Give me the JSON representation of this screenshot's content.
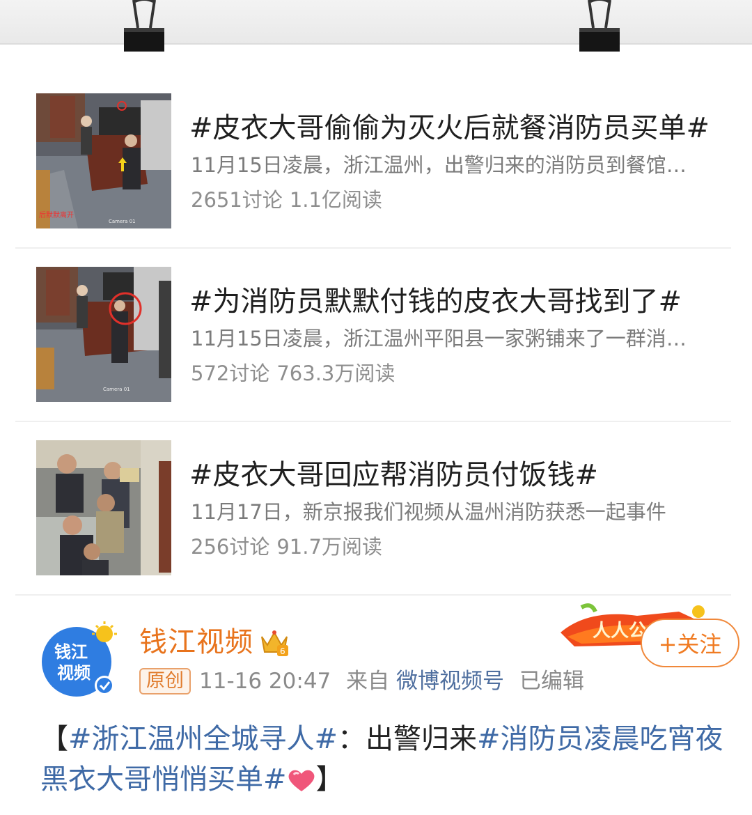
{
  "topics": [
    {
      "title": "#皮衣大哥偷偷为灭火后就餐消防员买单#",
      "desc": "11月15日凌晨，浙江温州，出警归来的消防员到餐馆吃宵夜",
      "discuss": "2651讨论",
      "reads": "1.1亿阅读"
    },
    {
      "title": "#为消防员默默付钱的皮衣大哥找到了#",
      "desc": "11月15日凌晨，浙江温州平阳县一家粥铺来了一群消防员",
      "discuss": "572讨论",
      "reads": "763.3万阅读"
    },
    {
      "title": "#皮衣大哥回应帮消防员付饭钱#",
      "desc": "11月17日，新京报我们视频从温州消防获悉一起事件",
      "discuss": "256讨论",
      "reads": "91.7万阅读"
    }
  ],
  "post": {
    "avatar_text_1": "钱江",
    "avatar_text_2": "视频",
    "username": "钱江视频",
    "crown_level": "6",
    "banner_text": "人人公",
    "follow_label": "+关注",
    "original_badge": "原创",
    "time": "11-16 20:47",
    "from_prefix": "来自",
    "source": "微博视频号",
    "edited": "已编辑",
    "text_bracket_open": "【",
    "tag_1": "#浙江温州全城寻人#",
    "text_colon": "：出警归来",
    "tag_2": "#消防员凌晨吃宵夜黑衣大哥悄悄买单#",
    "text_bracket_close": "】"
  },
  "colors": {
    "username": "#e8731c",
    "link": "#3f6aa6",
    "follow": "#f07b22",
    "source": "#4f6f9f"
  }
}
